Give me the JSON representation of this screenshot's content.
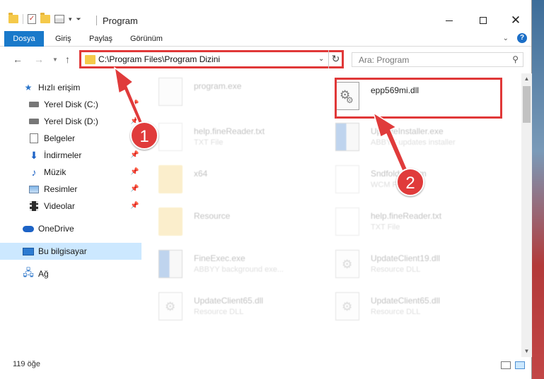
{
  "window": {
    "title": "Program",
    "controls": {
      "minimize": "minimize",
      "maximize": "maximize",
      "close": "✕"
    }
  },
  "ribbon": {
    "tabs": [
      {
        "label": "Dosya"
      },
      {
        "label": "Giriş"
      },
      {
        "label": "Paylaş"
      },
      {
        "label": "Görünüm"
      }
    ]
  },
  "address_bar": {
    "path": "C:\\Program Files\\Program Dizini"
  },
  "search": {
    "placeholder": "Ara: Program"
  },
  "sidebar": {
    "items": [
      {
        "label": "Hızlı erişim",
        "icon": "star-icon"
      },
      {
        "label": "Yerel Disk (C:)",
        "icon": "drive-icon"
      },
      {
        "label": "Yerel Disk (D:)",
        "icon": "drive-icon"
      },
      {
        "label": "Belgeler",
        "icon": "document-icon"
      },
      {
        "label": "İndirmeler",
        "icon": "download-icon"
      },
      {
        "label": "Müzik",
        "icon": "music-icon"
      },
      {
        "label": "Resimler",
        "icon": "pictures-icon"
      },
      {
        "label": "Videolar",
        "icon": "video-icon"
      },
      {
        "label": "OneDrive",
        "icon": "cloud-icon"
      },
      {
        "label": "Bu bilgisayar",
        "icon": "computer-icon"
      },
      {
        "label": "Ağ",
        "icon": "network-icon"
      }
    ]
  },
  "files": [
    {
      "name": "program.exe",
      "type": ""
    },
    {
      "name": "epp569mi.dll",
      "type": ""
    },
    {
      "name": "help.fineReader.txt",
      "type": "TXT File"
    },
    {
      "name": "UpdateInstaller.exe",
      "type": "ABBYY updates installer"
    },
    {
      "name": "x64",
      "type": ""
    },
    {
      "name": "Sndfolder.wcm",
      "type": "WCM File"
    },
    {
      "name": "Resource",
      "type": ""
    },
    {
      "name": "help.fineReader.txt",
      "type": "TXT File"
    },
    {
      "name": "FineExec.exe",
      "type": "ABBYY background exe..."
    },
    {
      "name": "UpdateClient19.dll",
      "type": "Resource DLL"
    },
    {
      "name": "UpdateClient65.dll",
      "type": "Resource DLL"
    },
    {
      "name": "UpdateClient65.dll",
      "type": "Resource DLL"
    }
  ],
  "status_bar": {
    "item_count": "119 öğe"
  },
  "annotations": [
    {
      "label": "1"
    },
    {
      "label": "2"
    }
  ],
  "colors": {
    "accent": "#1979ca",
    "highlight": "#e03838",
    "selection": "#cce8ff"
  }
}
